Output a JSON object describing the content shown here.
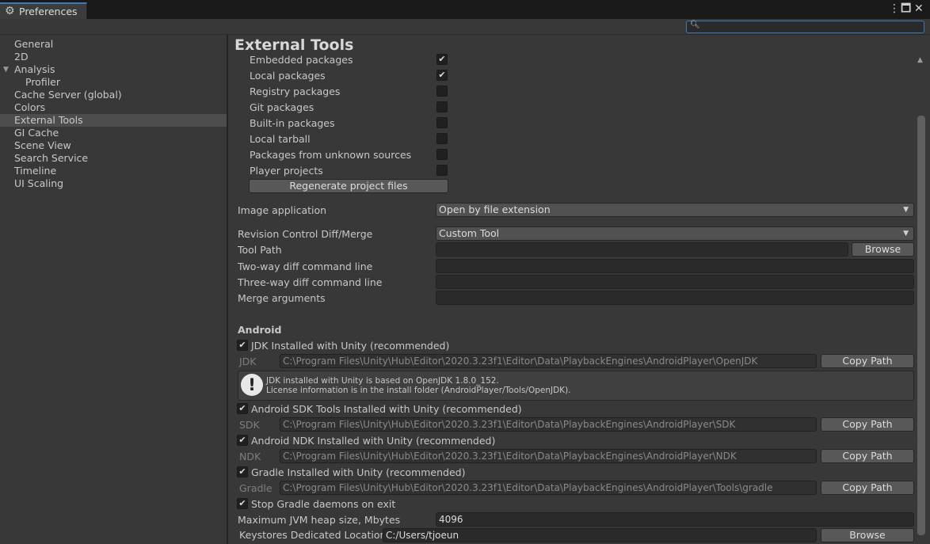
{
  "window": {
    "tab_title": "Preferences",
    "search_placeholder": ""
  },
  "sidebar": {
    "items": [
      {
        "label": "General"
      },
      {
        "label": "2D"
      },
      {
        "label": "Analysis"
      },
      {
        "label": "Profiler"
      },
      {
        "label": "Cache Server (global)"
      },
      {
        "label": "Colors"
      },
      {
        "label": "External Tools"
      },
      {
        "label": "GI Cache"
      },
      {
        "label": "Scene View"
      },
      {
        "label": "Search Service"
      },
      {
        "label": "Timeline"
      },
      {
        "label": "UI Scaling"
      }
    ],
    "selected": "External Tools"
  },
  "main": {
    "title": "External Tools",
    "packages": [
      {
        "label": "Embedded packages",
        "checked": true
      },
      {
        "label": "Local packages",
        "checked": true
      },
      {
        "label": "Registry packages",
        "checked": false
      },
      {
        "label": "Git packages",
        "checked": false
      },
      {
        "label": "Built-in packages",
        "checked": false
      },
      {
        "label": "Local tarball",
        "checked": false
      },
      {
        "label": "Packages from unknown sources",
        "checked": false
      },
      {
        "label": "Player projects",
        "checked": false
      }
    ],
    "regenerate_label": "Regenerate project files",
    "image_app": {
      "label": "Image application",
      "value": "Open by file extension"
    },
    "diff_merge": {
      "label": "Revision Control Diff/Merge",
      "value": "Custom Tool"
    },
    "tool_path": {
      "label": "Tool Path",
      "value": "",
      "browse": "Browse"
    },
    "two_way": {
      "label": "Two-way diff command line",
      "value": ""
    },
    "three_way": {
      "label": "Three-way diff command line",
      "value": ""
    },
    "merge_args": {
      "label": "Merge arguments",
      "value": ""
    },
    "android": {
      "title": "Android",
      "jdk_check": {
        "label": "JDK Installed with Unity (recommended)",
        "checked": true
      },
      "jdk": {
        "label": "JDK",
        "path": "C:\\Program Files\\Unity\\Hub\\Editor\\2020.3.23f1\\Editor\\Data\\PlaybackEngines\\AndroidPlayer\\OpenJDK",
        "copy": "Copy Path"
      },
      "info_line1": "JDK installed with Unity is based on OpenJDK 1.8.0_152.",
      "info_line2": "License information is in the install folder (AndroidPlayer/Tools/OpenJDK).",
      "sdk_check": {
        "label": "Android SDK Tools Installed with Unity (recommended)",
        "checked": true
      },
      "sdk": {
        "label": "SDK",
        "path": "C:\\Program Files\\Unity\\Hub\\Editor\\2020.3.23f1\\Editor\\Data\\PlaybackEngines\\AndroidPlayer\\SDK",
        "copy": "Copy Path"
      },
      "ndk_check": {
        "label": "Android NDK Installed with Unity (recommended)",
        "checked": true
      },
      "ndk": {
        "label": "NDK",
        "path": "C:\\Program Files\\Unity\\Hub\\Editor\\2020.3.23f1\\Editor\\Data\\PlaybackEngines\\AndroidPlayer\\NDK",
        "copy": "Copy Path"
      },
      "gradle_check": {
        "label": "Gradle Installed with Unity (recommended)",
        "checked": true
      },
      "gradle": {
        "label": "Gradle",
        "path": "C:\\Program Files\\Unity\\Hub\\Editor\\2020.3.23f1\\Editor\\Data\\PlaybackEngines\\AndroidPlayer\\Tools\\gradle",
        "copy": "Copy Path"
      },
      "stop_daemons": {
        "label": "Stop Gradle daemons on exit",
        "checked": true
      },
      "jvm_heap": {
        "label": "Maximum JVM heap size, Mbytes",
        "value": "4096"
      },
      "keystores": {
        "label": "Keystores Dedicated Location",
        "value": "C:/Users/tjoeun",
        "browse": "Browse"
      }
    }
  },
  "icons": {
    "check": "✔",
    "caret": "▼",
    "warning": "!"
  }
}
